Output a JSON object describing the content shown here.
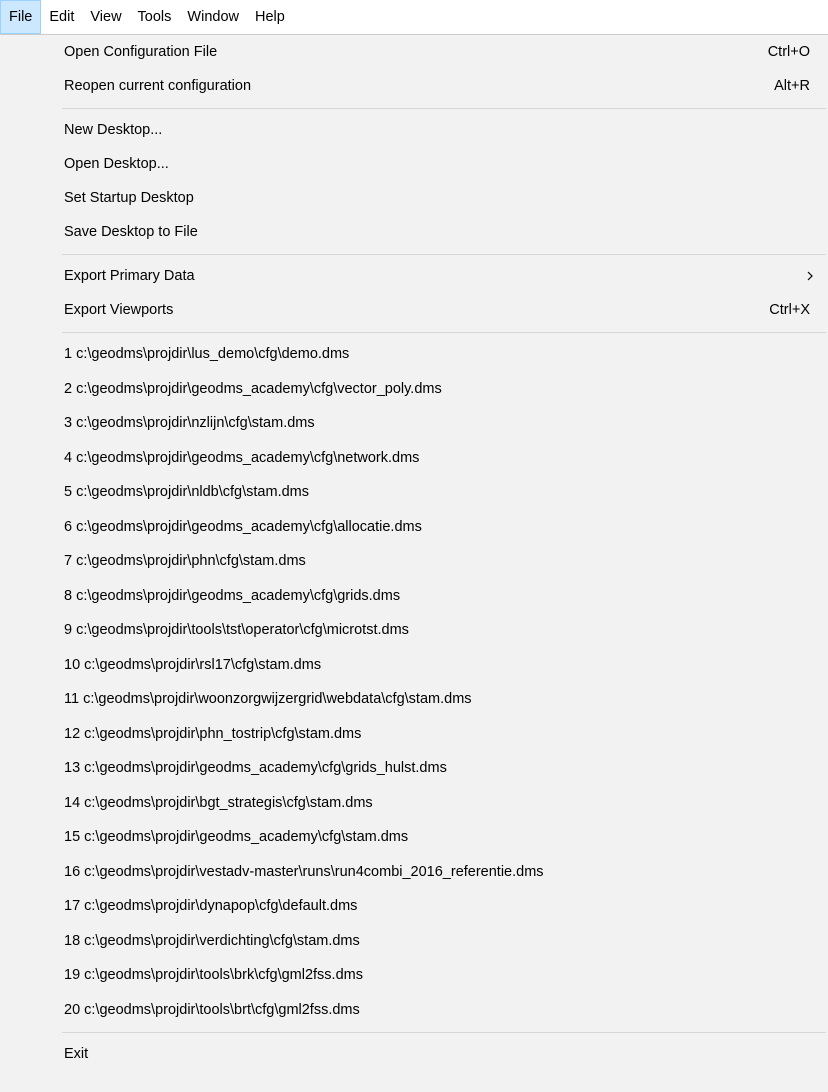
{
  "menubar": {
    "items": [
      "File",
      "Edit",
      "View",
      "Tools",
      "Window",
      "Help"
    ]
  },
  "file_menu": {
    "open_config": {
      "label": "Open Configuration File",
      "shortcut": "Ctrl+O"
    },
    "reopen": {
      "label": "Reopen current configuration",
      "shortcut": "Alt+R"
    },
    "new_desktop": {
      "label": "New Desktop..."
    },
    "open_desktop": {
      "label": "Open Desktop..."
    },
    "set_startup_desktop": {
      "label": "Set Startup Desktop"
    },
    "save_desktop": {
      "label": "Save Desktop to File"
    },
    "export_primary": {
      "label": "Export Primary Data"
    },
    "export_viewports": {
      "label": "Export Viewports",
      "shortcut": "Ctrl+X"
    },
    "recent_files": [
      "1 c:\\geodms\\projdir\\lus_demo\\cfg\\demo.dms",
      "2 c:\\geodms\\projdir\\geodms_academy\\cfg\\vector_poly.dms",
      "3 c:\\geodms\\projdir\\nzlijn\\cfg\\stam.dms",
      "4 c:\\geodms\\projdir\\geodms_academy\\cfg\\network.dms",
      "5 c:\\geodms\\projdir\\nldb\\cfg\\stam.dms",
      "6 c:\\geodms\\projdir\\geodms_academy\\cfg\\allocatie.dms",
      "7 c:\\geodms\\projdir\\phn\\cfg\\stam.dms",
      "8 c:\\geodms\\projdir\\geodms_academy\\cfg\\grids.dms",
      "9 c:\\geodms\\projdir\\tools\\tst\\operator\\cfg\\microtst.dms",
      "10 c:\\geodms\\projdir\\rsl17\\cfg\\stam.dms",
      "11 c:\\geodms\\projdir\\woonzorgwijzergrid\\webdata\\cfg\\stam.dms",
      "12 c:\\geodms\\projdir\\phn_tostrip\\cfg\\stam.dms",
      "13 c:\\geodms\\projdir\\geodms_academy\\cfg\\grids_hulst.dms",
      "14 c:\\geodms\\projdir\\bgt_strategis\\cfg\\stam.dms",
      "15 c:\\geodms\\projdir\\geodms_academy\\cfg\\stam.dms",
      "16 c:\\geodms\\projdir\\vestadv-master\\runs\\run4combi_2016_referentie.dms",
      "17 c:\\geodms\\projdir\\dynapop\\cfg\\default.dms",
      "18 c:\\geodms\\projdir\\verdichting\\cfg\\stam.dms",
      "19 c:\\geodms\\projdir\\tools\\brk\\cfg\\gml2fss.dms",
      "20 c:\\geodms\\projdir\\tools\\brt\\cfg\\gml2fss.dms"
    ],
    "exit": {
      "label": "Exit"
    }
  },
  "colors": {
    "menu_background": "#f2f2f2",
    "active_menubar_item": "#cce8ff",
    "active_menubar_border": "#99d1ff",
    "separator": "#d7d7d7"
  },
  "icons": {
    "submenu_indicator": "chevron-right-icon"
  }
}
